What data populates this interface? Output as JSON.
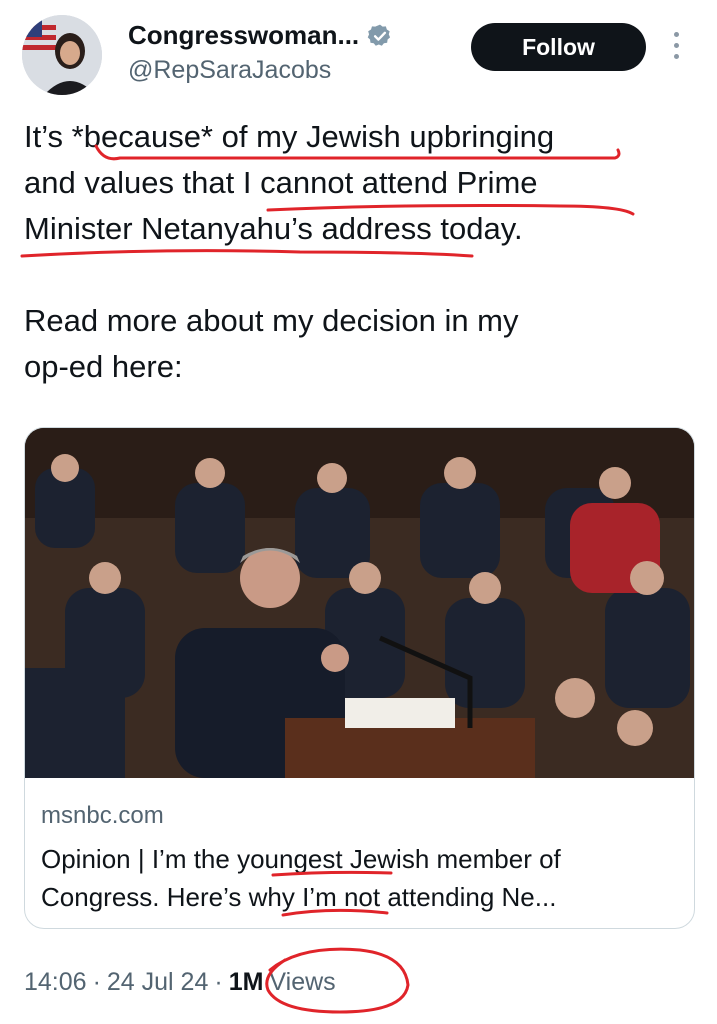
{
  "author": {
    "display_name": "Congresswoman...",
    "handle": "@RepSaraJacobs",
    "verified_icon": "verified-badge-icon",
    "follow_label": "Follow"
  },
  "tweet": {
    "paragraph1": "It’s *because* of my Jewish upbringing\nand values that I cannot attend Prime\nMinister Netanyahu’s address today.",
    "paragraph2": "Read more about my decision in my\nop-ed here:"
  },
  "link_card": {
    "domain": "msnbc.com",
    "title": "Opinion | I’m the youngest Jewish member of Congress. Here’s why I’m not attending Ne..."
  },
  "meta": {
    "time": "14:06",
    "date": "24 Jul 24",
    "views_count": "1M",
    "views_label": "Views"
  },
  "colors": {
    "annotation": "#e0242a",
    "text_primary": "#0f1419",
    "text_secondary": "#536471",
    "verified": "#829aab"
  }
}
